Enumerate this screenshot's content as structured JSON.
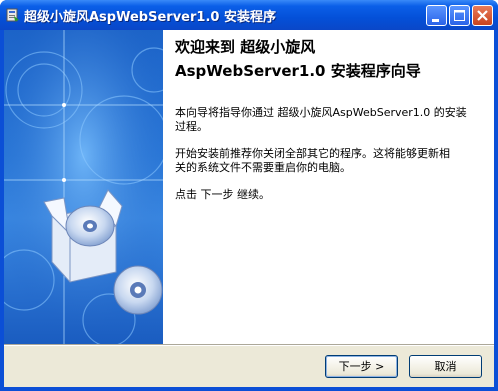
{
  "window": {
    "title": "超级小旋风AspWebServer1.0  安装程序"
  },
  "content": {
    "heading_line1": "欢迎来到 超级小旋风",
    "heading_line2": "AspWebServer1.0 安装程序向导",
    "para1_line1": "本向导将指导你通过 超级小旋风AspWebServer1.0 的安装",
    "para1_line2": "过程。",
    "para2_line1": "开始安装前推荐你关闭全部其它的程序。这将能够更新相",
    "para2_line2": "关的系统文件不需要重启你的电脑。",
    "para3": "点击 下一步 继续。"
  },
  "buttons": {
    "next": "下一步 >",
    "cancel": "取消"
  },
  "icons": {
    "app": "installer-icon",
    "minimize": "minimize-icon",
    "maximize": "maximize-icon",
    "close": "close-icon"
  },
  "colors": {
    "titlebar": "#0450d8",
    "banner": "#2a78d8",
    "close_button": "#c8431e"
  }
}
